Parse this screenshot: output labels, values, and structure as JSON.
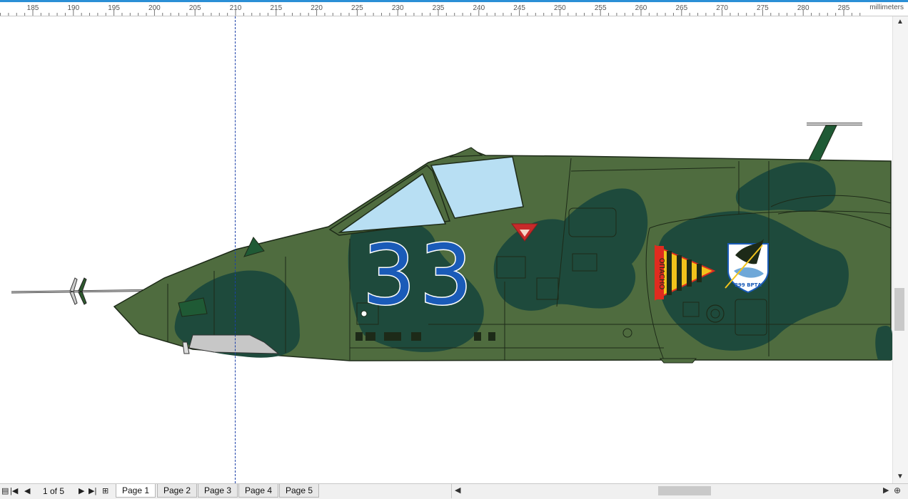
{
  "ruler": {
    "units": "millimeters",
    "labels": [
      "185",
      "190",
      "195",
      "200",
      "205",
      "210",
      "215",
      "220",
      "225",
      "230",
      "235",
      "240",
      "245",
      "250",
      "255",
      "260",
      "265",
      "270",
      "275",
      "280",
      "285"
    ]
  },
  "drawing": {
    "tail_number": "33",
    "warning_text": "ОПАСНО",
    "emblem_text": "299 ВРТА",
    "colors": {
      "base_green": "#4f6c3f",
      "camo_dark": "#1e4a3c",
      "canopy": "#b8dff3",
      "number_blue": "#1a5bb8",
      "warning_red": "#e02b1f",
      "warning_yellow": "#f2c31c"
    }
  },
  "navigation": {
    "first_icon": "first-page-icon",
    "prev_icon": "prev-page-icon",
    "page_info": "1 of 5",
    "next_icon": "next-page-icon",
    "last_icon": "last-page-icon",
    "add_icon": "add-page-icon"
  },
  "tabs": [
    "Page 1",
    "Page 2",
    "Page 3",
    "Page 4",
    "Page 5"
  ],
  "active_tab": "Page 1"
}
